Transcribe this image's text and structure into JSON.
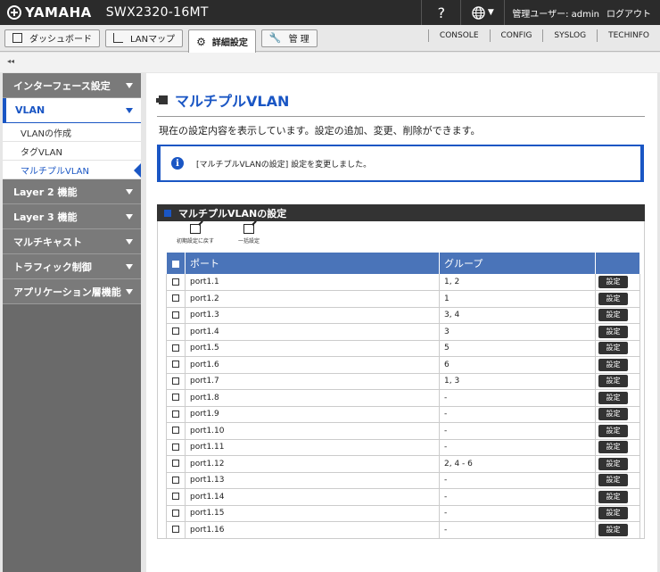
{
  "header": {
    "brand": "YAMAHA",
    "model": "SWX2320-16MT",
    "help": "?",
    "user": "管理ユーザー: admin",
    "logout": "ログアウト"
  },
  "nav": {
    "tabs": [
      {
        "label": "ダッシュボード"
      },
      {
        "label": "LANマップ"
      },
      {
        "label": "詳細設定"
      },
      {
        "label": "管 理"
      }
    ],
    "links": [
      "CONSOLE",
      "CONFIG",
      "SYSLOG",
      "TECHINFO"
    ]
  },
  "sidebar": {
    "collapse": "◂◂",
    "items": [
      {
        "label": "インターフェース設定"
      },
      {
        "label": "VLAN"
      },
      {
        "label": "Layer 2 機能"
      },
      {
        "label": "Layer 3 機能"
      },
      {
        "label": "マルチキャスト"
      },
      {
        "label": "トラフィック制御"
      },
      {
        "label": "アプリケーション層機能"
      }
    ],
    "vlan_sub": [
      "VLANの作成",
      "タグVLAN",
      "マルチプルVLAN"
    ]
  },
  "main": {
    "title": "マルチプルVLAN",
    "description": "現在の設定内容を表示しています。設定の追加、変更、削除ができます。",
    "notice": "[マルチプルVLANの設定] 設定を変更しました。",
    "panel_title": "マルチプルVLANの設定",
    "tools": [
      "初期設定に戻す",
      "一括設定"
    ],
    "table": {
      "headers": [
        "ポート",
        "グループ"
      ],
      "button_label": "設定",
      "rows": [
        {
          "port": "port1.1",
          "group": "1, 2"
        },
        {
          "port": "port1.2",
          "group": "1"
        },
        {
          "port": "port1.3",
          "group": "3, 4"
        },
        {
          "port": "port1.4",
          "group": "3"
        },
        {
          "port": "port1.5",
          "group": "5"
        },
        {
          "port": "port1.6",
          "group": "6"
        },
        {
          "port": "port1.7",
          "group": "1, 3"
        },
        {
          "port": "port1.8",
          "group": "-"
        },
        {
          "port": "port1.9",
          "group": "-"
        },
        {
          "port": "port1.10",
          "group": "-"
        },
        {
          "port": "port1.11",
          "group": "-"
        },
        {
          "port": "port1.12",
          "group": "2, 4 - 6"
        },
        {
          "port": "port1.13",
          "group": "-"
        },
        {
          "port": "port1.14",
          "group": "-"
        },
        {
          "port": "port1.15",
          "group": "-"
        },
        {
          "port": "port1.16",
          "group": "-"
        }
      ]
    }
  }
}
